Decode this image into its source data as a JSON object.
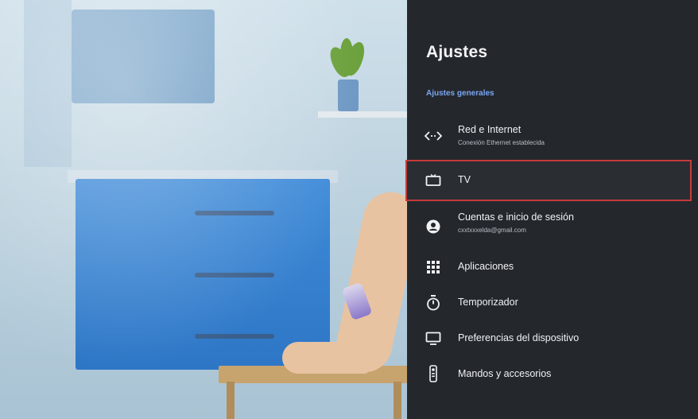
{
  "settings": {
    "title": "Ajustes",
    "section_label": "Ajustes generales",
    "items": [
      {
        "label": "Red e Internet",
        "sublabel": "Conexión Ethernet establecida",
        "icon": "network-icon"
      },
      {
        "label": "TV",
        "sublabel": "",
        "icon": "tv-icon",
        "selected": true
      },
      {
        "label": "Cuentas e inicio de sesión",
        "sublabel": "cxxtxxxelda@gmail.com",
        "icon": "account-icon"
      },
      {
        "label": "Aplicaciones",
        "sublabel": "",
        "icon": "apps-grid-icon"
      },
      {
        "label": "Temporizador",
        "sublabel": "",
        "icon": "timer-icon"
      },
      {
        "label": "Preferencias del dispositivo",
        "sublabel": "",
        "icon": "monitor-icon"
      },
      {
        "label": "Mandos y accesorios",
        "sublabel": "",
        "icon": "remote-icon"
      }
    ]
  },
  "colors": {
    "panel_bg": "#24282d",
    "section_accent": "#7ba6f2",
    "selection_outline": "#c73a3a"
  }
}
